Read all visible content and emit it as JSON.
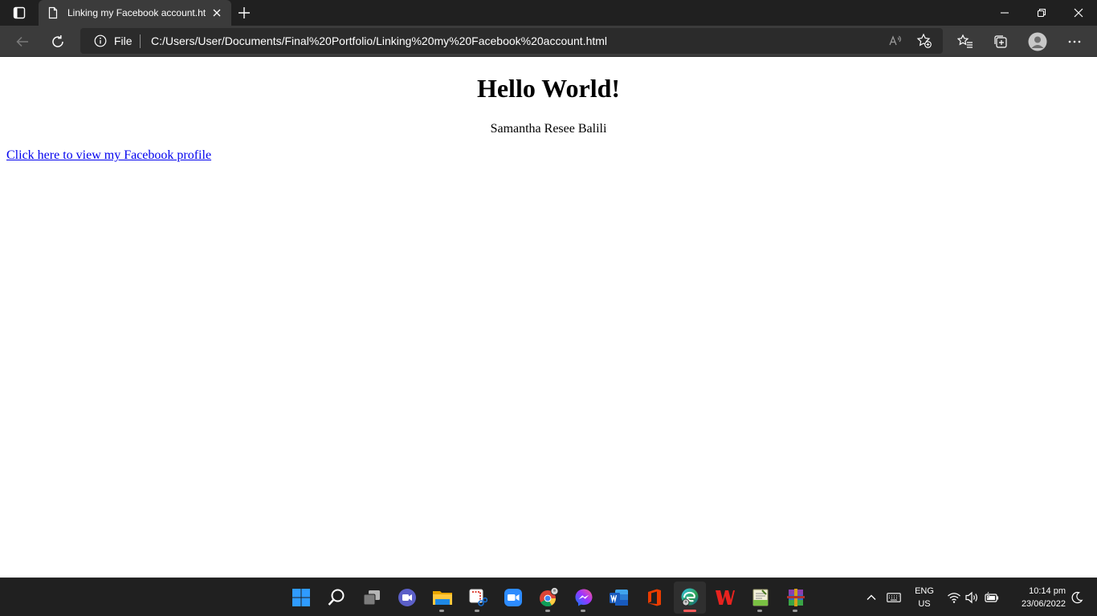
{
  "browser": {
    "tab": {
      "title": "Linking my Facebook account.html"
    },
    "address": {
      "scheme_label": "File",
      "url": "C:/Users/User/Documents/Final%20Portfolio/Linking%20my%20Facebook%20account.html"
    }
  },
  "page": {
    "heading": "Hello World!",
    "author": "Samantha Resee Balili",
    "link_text": "Click here to view my Facebook profile",
    "link_color": "#0000ee"
  },
  "taskbar": {
    "apps": [
      {
        "name": "start",
        "icon": "windows-logo-icon"
      },
      {
        "name": "search",
        "icon": "search-icon"
      },
      {
        "name": "task-view",
        "icon": "task-view-icon"
      },
      {
        "name": "teams-chat",
        "icon": "chat-icon"
      },
      {
        "name": "file-explorer",
        "icon": "folder-icon"
      },
      {
        "name": "snipping-tool",
        "icon": "snip-icon"
      },
      {
        "name": "zoom",
        "icon": "video-camera-icon"
      },
      {
        "name": "chrome",
        "icon": "chrome-icon"
      },
      {
        "name": "messenger",
        "icon": "messenger-icon"
      },
      {
        "name": "word",
        "icon": "word-icon"
      },
      {
        "name": "office",
        "icon": "office-icon"
      },
      {
        "name": "edge",
        "icon": "edge-icon"
      },
      {
        "name": "wps-office",
        "icon": "wps-icon"
      },
      {
        "name": "notepad-plus",
        "icon": "notepad-icon"
      },
      {
        "name": "winrar",
        "icon": "archive-icon"
      }
    ],
    "language": {
      "line1": "ENG",
      "line2": "US"
    },
    "clock": {
      "time": "10:14 pm",
      "date": "23/06/2022"
    }
  },
  "colors": {
    "titlebar": "#202020",
    "toolbar": "#3b3b3b",
    "taskbar": "#202020",
    "edge_indicator": "#ff5a5a"
  }
}
